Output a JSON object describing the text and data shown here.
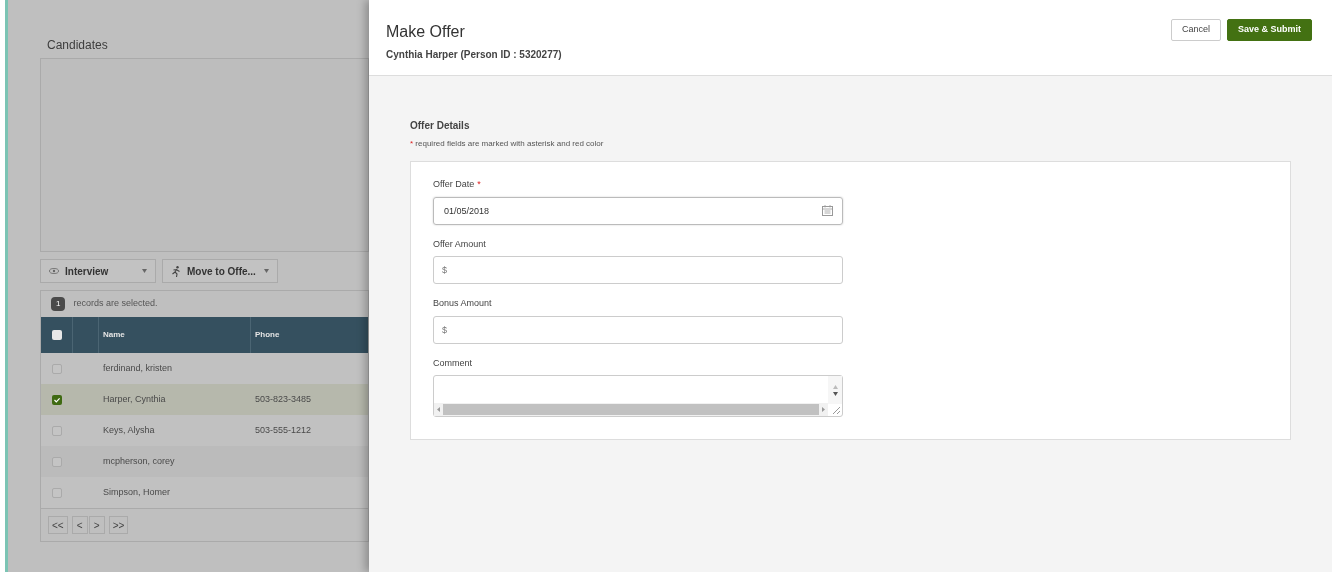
{
  "background": {
    "title": "Candidates",
    "actions": [
      {
        "kind": "view",
        "label": "Interview"
      },
      {
        "kind": "move",
        "label": "Move to Offe..."
      }
    ],
    "selection": {
      "count": "1",
      "text": "records are selected."
    },
    "table": {
      "columns": [
        "Name",
        "Phone"
      ],
      "header_checked": false,
      "rows": [
        {
          "name": "ferdinand, kristen",
          "phone": "",
          "checked": false,
          "selected": false
        },
        {
          "name": "Harper, Cynthia",
          "phone": "503-823-3485",
          "checked": true,
          "selected": true
        },
        {
          "name": "Keys, Alysha",
          "phone": "503-555-1212",
          "checked": false,
          "selected": false
        },
        {
          "name": "mcpherson, corey",
          "phone": "",
          "checked": false,
          "selected": false
        },
        {
          "name": "Simpson, Homer",
          "phone": "",
          "checked": false,
          "selected": false
        }
      ]
    },
    "pager": [
      "<<",
      "<",
      ">",
      ">>"
    ]
  },
  "dialog": {
    "title": "Make Offer",
    "subtitle": "Cynthia Harper (Person ID : 5320277)",
    "buttons": [
      {
        "kind": "secondary",
        "label": "Cancel"
      },
      {
        "kind": "primary",
        "label": "Save & Submit"
      }
    ],
    "section": {
      "title": "Offer Details",
      "required_mark": "*",
      "note": "required fields are marked with asterisk and red color",
      "fields": [
        {
          "kind": "date",
          "label": "Offer Date",
          "required": true,
          "value": "01/05/2018"
        },
        {
          "kind": "text",
          "label": "Offer Amount",
          "required": false,
          "placeholder": "$"
        },
        {
          "kind": "text",
          "label": "Bonus Amount",
          "required": false,
          "placeholder": "$"
        },
        {
          "kind": "textarea",
          "label": "Comment",
          "required": false
        }
      ]
    }
  }
}
